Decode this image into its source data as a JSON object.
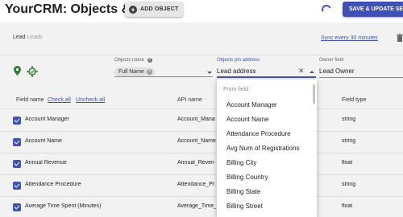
{
  "header": {
    "title": "YourCRM: Objects & fields",
    "add_object_label": "ADD OBJECT",
    "save_label": "SAVE & UPDATE SET"
  },
  "object": {
    "name": "Lead",
    "subtitle": "Leads",
    "sync_label": "Sync every 30 minutes"
  },
  "filters": {
    "objects_name_label": "Objects name",
    "objects_name_chip": "Full Name",
    "pin_address_label": "Objects pin address",
    "pin_address_value": "Lead address",
    "owner_field_label": "Owner field",
    "owner_field_value": "Lead Owner"
  },
  "table": {
    "columns": {
      "field_name": "Field name",
      "check_all": "Check all",
      "uncheck_all": "Uncheck all",
      "api_name": "API name",
      "field_type": "Field type"
    },
    "rows": [
      {
        "name": "Account Manager",
        "api": "Account_Mana",
        "type": "string",
        "checked": true
      },
      {
        "name": "Account Name",
        "api": "Account_Name",
        "type": "string",
        "checked": true
      },
      {
        "name": "Annual Revenue",
        "api": "Annual_Reven",
        "type": "float",
        "checked": true
      },
      {
        "name": "Attendance Procedure",
        "api": "Attendance_Pr",
        "type": "string",
        "checked": true
      },
      {
        "name": "Average Time Spent (Minutes)",
        "api": "Average_Time_",
        "type": "float",
        "checked": true
      }
    ]
  },
  "dropdown": {
    "header": "From field",
    "items": [
      "Account Manager",
      "Account Name",
      "Attendance Procedure",
      "Avg Num of Registrations",
      "Billing City",
      "Billing Country",
      "Billing State",
      "Billing Street"
    ]
  },
  "colors": {
    "primary": "#3f51b5",
    "location_green": "#2e7d32"
  },
  "icons": [
    "plus-circle-icon",
    "spinner-icon",
    "trash-icon",
    "location-pin-icon",
    "crosshair-icon",
    "help-icon",
    "close-icon",
    "chevron-down-icon",
    "chevron-up-icon",
    "checkbox-checked-icon"
  ]
}
